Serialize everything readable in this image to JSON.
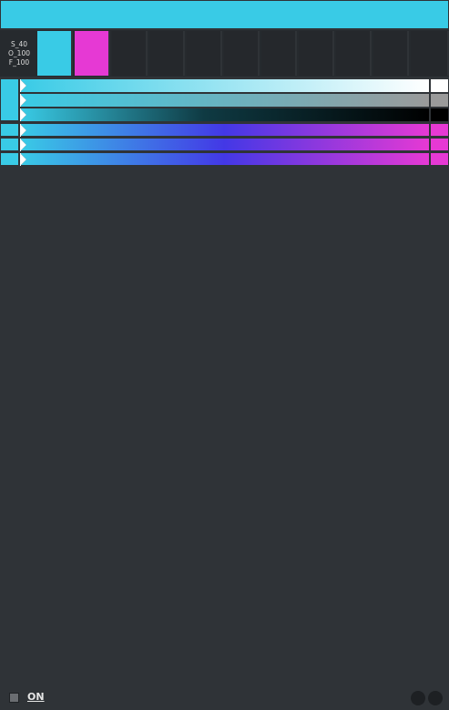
{
  "colors": {
    "base": "#39cbe6",
    "secondary": "#e639d4",
    "mid": "#4338e6",
    "white": "#ffffff",
    "gray": "#9a9a9a",
    "black": "#000000",
    "background": "#2f3337"
  },
  "info": {
    "s": "S_40",
    "o": "O_100",
    "f": "F_100"
  },
  "footer": {
    "toggle_label": "ON"
  }
}
